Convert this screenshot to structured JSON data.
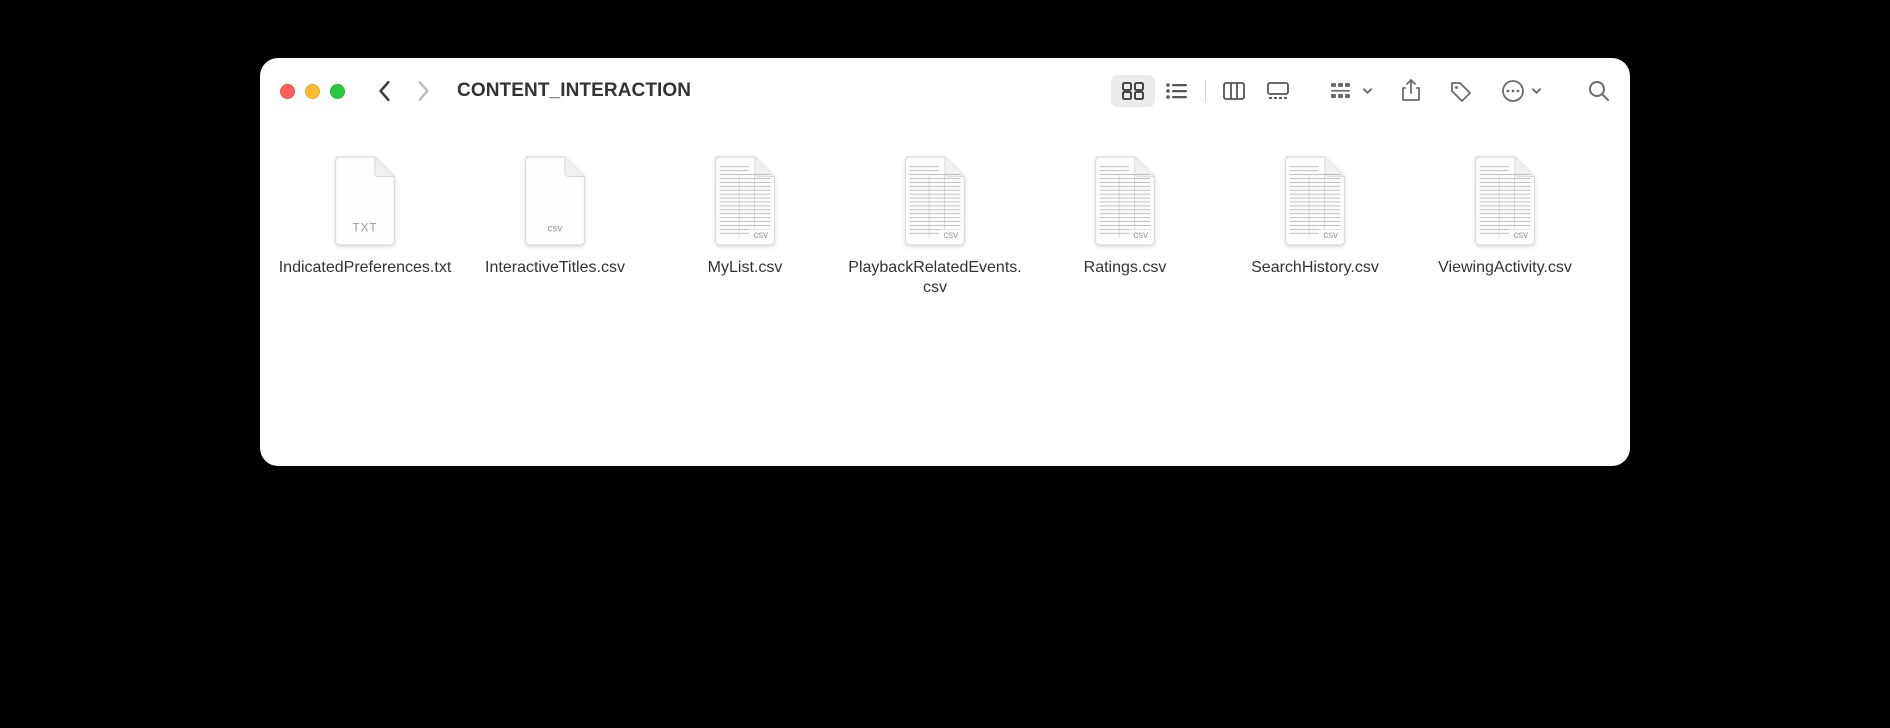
{
  "window": {
    "title": "CONTENT_INTERACTION"
  },
  "files": [
    {
      "name": "IndicatedPreferences.txt",
      "type": "txt",
      "type_label": "TXT"
    },
    {
      "name": "InteractiveTitles.csv",
      "type": "csv-blank",
      "type_label": "csv"
    },
    {
      "name": "MyList.csv",
      "type": "csv-data",
      "type_label": "csv"
    },
    {
      "name": "PlaybackRelatedEvents.csv",
      "type": "csv-data",
      "type_label": "csv"
    },
    {
      "name": "Ratings.csv",
      "type": "csv-data",
      "type_label": "csv"
    },
    {
      "name": "SearchHistory.csv",
      "type": "csv-data",
      "type_label": "csv"
    },
    {
      "name": "ViewingActivity.csv",
      "type": "csv-data",
      "type_label": "csv"
    }
  ]
}
